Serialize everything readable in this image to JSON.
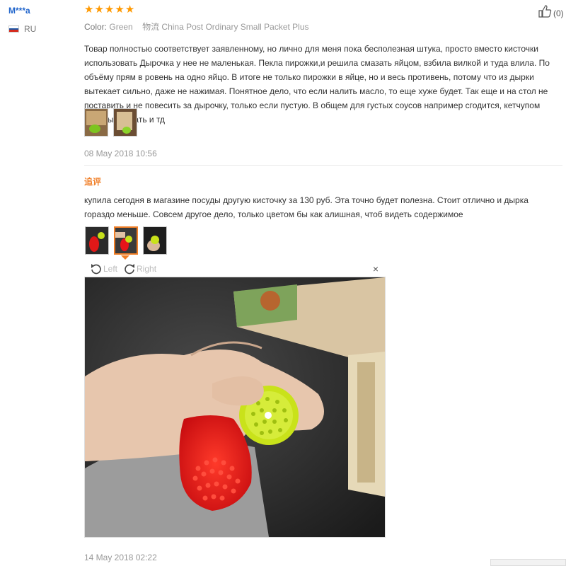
{
  "user": {
    "name": "M***a",
    "country": "RU"
  },
  "review": {
    "rating": 5,
    "color_label": "Color:",
    "color_value": "Green",
    "shipping_label": "物流",
    "shipping_value": "China Post Ordinary Small Packet Plus",
    "text": "Товар полностью соответствует заявленному, но лично для меня пока бесполезная штука, просто вместо кисточки использовать Дырочка у нее не маленькая. Пекла пирожки,и решила смазать яйцом, взбила вилкой и туда влила. По объёму прям в ровень на одно яйцо. В итоге не только пирожки в яйце, но и весь противень, потому что из дырки вытекает сильно, даже не нажимая. Понятное дело, что если налить масло, то еще хуже будет. Так еще и на стол не поставить и не повесить за дырочку, только если пустую. В общем для густых соусов например сгодится, кетчупом шашлык мазать и тд",
    "date": "08 May 2018 10:56",
    "likes": "(0)"
  },
  "followup": {
    "label": "追评",
    "text": "купила сегодня в магазине посуды другую кисточку за 130 руб. Эта точно будет полезна. Стоит отлично и дырка гораздо меньше. Совсем другое дело, только цветом бы как алишная, чтоб видеть содержимое",
    "date": "14 May 2018 02:22"
  },
  "viewer": {
    "rotate_left": "Left",
    "rotate_right": "Right",
    "close": "×"
  },
  "colors": {
    "star": "#ff9900",
    "accent": "#f07e26",
    "username": "#2266cc",
    "brush_red": "#e8141a",
    "brush_green": "#c9e21a"
  }
}
